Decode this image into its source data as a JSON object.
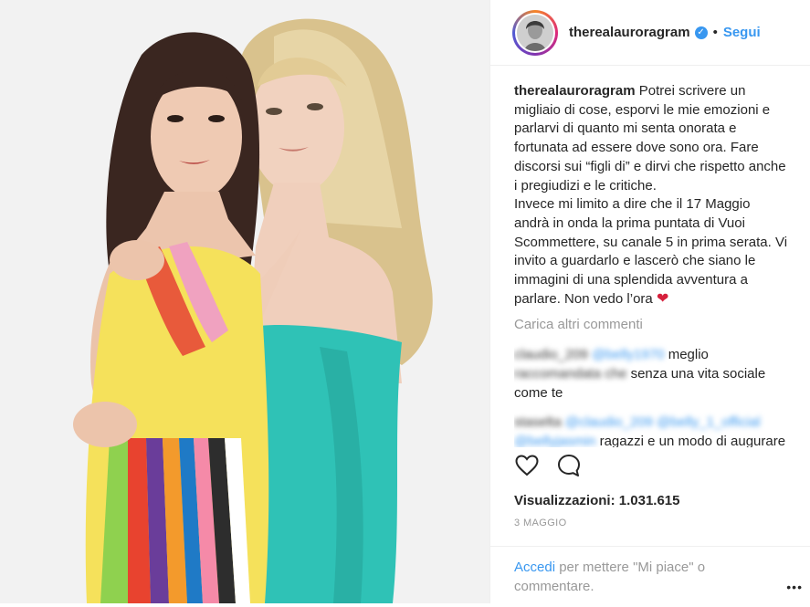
{
  "post": {
    "username": "therealauroragram",
    "verified_mark": "✓",
    "separator": "•",
    "follow_label": "Segui",
    "caption": "Potrei scrivere un migliaio di cose, esporvi le mie emozioni e parlarvi di quanto mi senta onorata e fortunata ad essere dove sono ora. Fare discorsi sui “figli di” e dirvi che rispetto anche i pregiudizi e le critiche.\nInvece mi limito a dire che il 17 Maggio andrà in onda la prima puntata di Vuoi Scommettere, su canale 5 in prima serata. Vi invito a guardarlo e lascerò che siano le immagini di una splendida avventura a parlare. Non vedo l’ora",
    "caption_emoji": "❤",
    "load_more_label": "Carica altri commenti",
    "comments": [
      {
        "user": "claudio_209",
        "mention": "@belly1970",
        "text_visible": "meglio",
        "text_blurred": "raccomandata che",
        "text_tail": "senza una vita sociale come te"
      },
      {
        "user": "staselta",
        "mention": "@claudio_209 @belly_1_official @bellyjasmin",
        "text_visible": "ragazzi e un modo di augurare buona fortuna nel mondo dello"
      }
    ],
    "views_label": "Visualizzazioni:",
    "views_count": "1.031.615",
    "date": "3 MAGGIO",
    "login_link": "Accedi",
    "login_text": " per mettere \"Mi piace\" o commentare.",
    "more_options": "•••"
  },
  "icons": {
    "like": "heart-outline-icon",
    "comment": "speech-bubble-icon",
    "verified": "verified-badge-icon",
    "options": "more-options-icon"
  },
  "colors": {
    "link": "#3897f0",
    "muted": "#999999",
    "text": "#262626",
    "dress_teal": "#2fc2b6"
  }
}
